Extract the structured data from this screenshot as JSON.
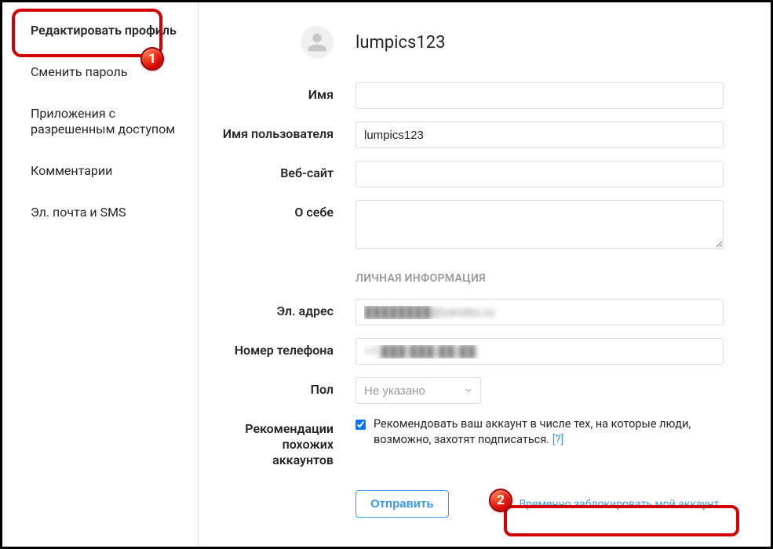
{
  "sidebar": {
    "items": [
      {
        "label": "Редактировать профиль"
      },
      {
        "label": "Сменить пароль"
      },
      {
        "label": "Приложения с разрешенным доступом"
      },
      {
        "label": "Комментарии"
      },
      {
        "label": "Эл. почта и SMS"
      }
    ]
  },
  "header": {
    "username": "lumpics123"
  },
  "form": {
    "name_label": "Имя",
    "name_value": "",
    "username_label": "Имя пользователя",
    "username_value": "lumpics123",
    "website_label": "Веб-сайт",
    "website_value": "",
    "bio_label": "О себе",
    "bio_value": "",
    "section_heading": "ЛИЧНАЯ ИНФОРМАЦИЯ",
    "email_label": "Эл. адрес",
    "email_value": "████████@yandex.ru",
    "phone_label": "Номер телефона",
    "phone_value": "+7 ███ ███-██-██",
    "gender_label": "Пол",
    "gender_value": "Не указано",
    "recommend_label": "Рекомендации похожих аккаунтов",
    "recommend_text": "Рекомендовать ваш аккаунт в числе тех, на которые люди, возможно, захотят подписаться.",
    "recommend_help": "[?]",
    "submit_label": "Отправить",
    "disable_link": "Временно заблокировать мой аккаунт"
  },
  "annotations": {
    "badge1": "1",
    "badge2": "2"
  }
}
